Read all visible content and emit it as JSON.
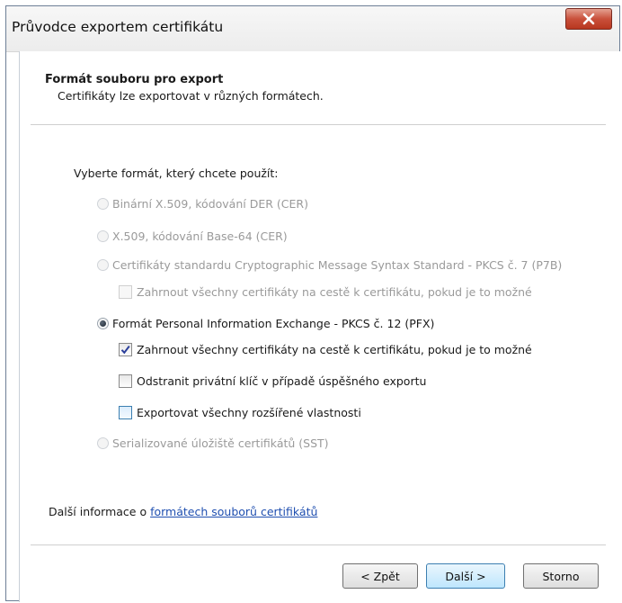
{
  "window": {
    "title": "Průvodce exportem certifikátu"
  },
  "header": {
    "title": "Formát souboru pro export",
    "subtitle": "Certifikáty lze exportovat v různých formátech."
  },
  "prompt": "Vyberte formát, který chcete použít:",
  "options": [
    {
      "label": "Binární X.509, kódování DER (CER)",
      "state": "disabled"
    },
    {
      "label": "X.509, kódování Base-64 (CER)",
      "state": "disabled"
    },
    {
      "label": "Certifikáty standardu Cryptographic Message Syntax Standard - PKCS č. 7 (P7B)",
      "state": "disabled"
    },
    {
      "label": "Formát Personal Information Exchange - PKCS č. 12 (PFX)",
      "state": "selected"
    },
    {
      "label": "Serializované úložiště certifikátů (SST)",
      "state": "disabled"
    }
  ],
  "checkboxes": {
    "p7b_include_all": {
      "label": "Zahrnout všechny certifikáty na cestě k certifikátu, pokud je to možné",
      "checked": false,
      "enabled": false
    },
    "pfx_include_all": {
      "label": "Zahrnout všechny certifikáty na cestě k certifikátu, pokud je to možné",
      "checked": true,
      "enabled": true
    },
    "pfx_delete_key": {
      "label": "Odstranit privátní klíč v případě úspěšného exportu",
      "checked": false,
      "enabled": true
    },
    "pfx_export_props": {
      "label": "Exportovat všechny rozšířené vlastnosti",
      "checked": false,
      "enabled": true
    }
  },
  "info": {
    "prefix": "Další informace o ",
    "link": "formátech souborů certifikátů"
  },
  "buttons": {
    "back": "< Zpět",
    "next": "Další >",
    "cancel": "Storno"
  },
  "colors": {
    "link": "#1f4fb0",
    "close_button": "#c9503b",
    "default_button_border": "#3c7fb1"
  }
}
